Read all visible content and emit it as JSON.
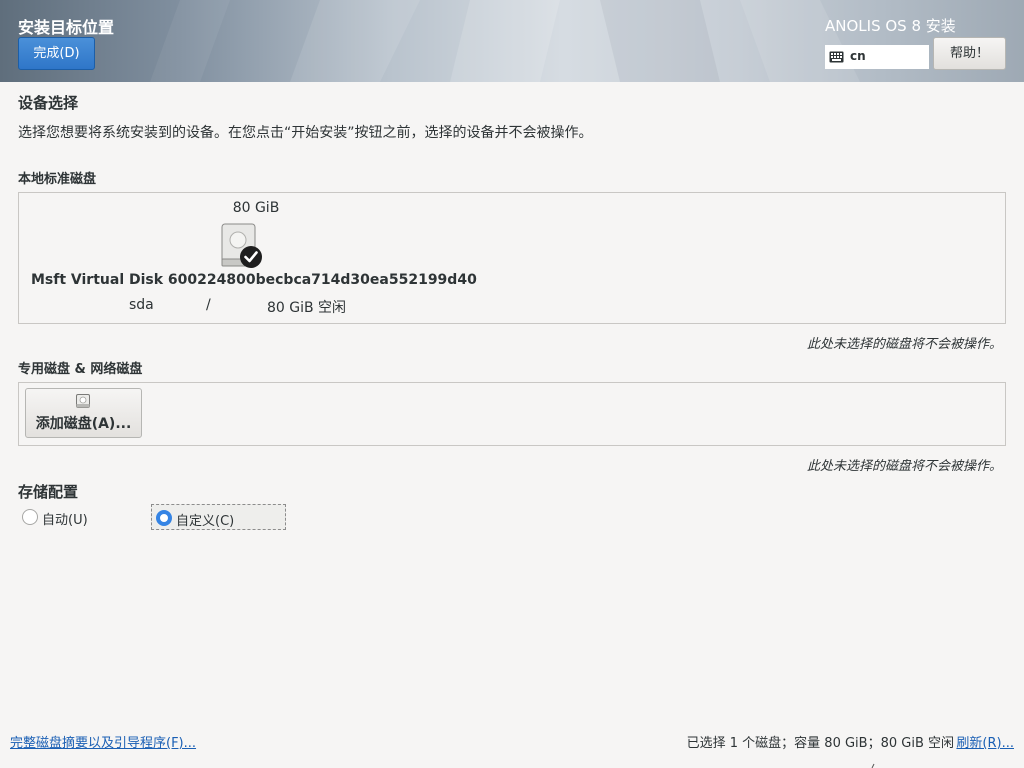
{
  "header": {
    "title": "安装目标位置",
    "done_label": "完成(D)",
    "product": "ANOLIS OS 8 安装",
    "keyboard_layout": "cn",
    "help_label": "帮助！"
  },
  "device_selection": {
    "title": "设备选择",
    "description": "选择您想要将系统安装到的设备。在您点击“开始安装”按钮之前，选择的设备并不会被操作。"
  },
  "local_disks": {
    "title": "本地标准磁盘",
    "disks": [
      {
        "size": "80 GiB",
        "name": "Msft Virtual Disk 600224800becbca714d30ea552199d40",
        "device": "sda",
        "mount": "/",
        "free": "80 GiB 空闲",
        "selected": true
      }
    ],
    "note": "此处未选择的磁盘将不会被操作。"
  },
  "special_disks": {
    "title": "专用磁盘 & 网络磁盘",
    "add_label": "添加磁盘(A)...",
    "note": "此处未选择的磁盘将不会被操作。"
  },
  "storage_config": {
    "title": "存储配置",
    "options": [
      {
        "label": "自动(U)",
        "selected": false
      },
      {
        "label": "自定义(C)",
        "selected": true
      }
    ]
  },
  "footer": {
    "summary_link": "完整磁盘摘要以及引导程序(F)...",
    "summary_text": "已选择 1 个磁盘；容量 80 GiB；80 GiB 空闲",
    "refresh_link": "刷新(R)..."
  },
  "colors": {
    "accent": "#3584e4",
    "link": "#1a5fb4",
    "done_button": "#3584e4"
  },
  "icons": {
    "keyboard": "keyboard-icon",
    "disk": "harddisk-icon",
    "selected": "checkmark-icon",
    "add_disk": "disk-add-icon"
  }
}
